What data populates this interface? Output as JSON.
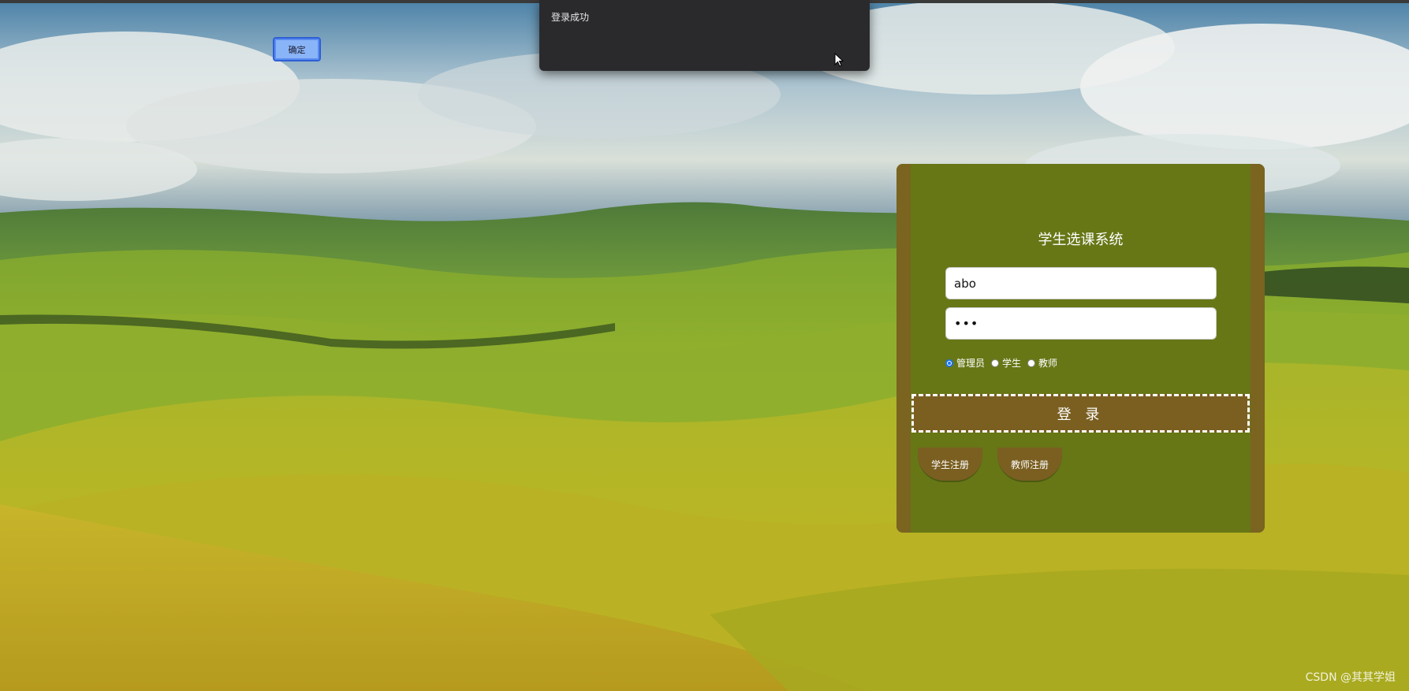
{
  "dialog": {
    "message": "登录成功",
    "ok_label": "确定"
  },
  "login": {
    "title": "学生选课系统",
    "username_value": "abo",
    "password_value": "•••",
    "roles": [
      {
        "label": "管理员",
        "checked": true
      },
      {
        "label": "学生",
        "checked": false
      },
      {
        "label": "教师",
        "checked": false
      }
    ],
    "login_label": "登 录",
    "student_register_label": "学生注册",
    "teacher_register_label": "教师注册"
  },
  "watermark": "CSDN @其其学姐",
  "colors": {
    "panel": "#677716",
    "panel_edge": "#7a6420",
    "button": "#7a5f21",
    "dialog": "#2a2a2d",
    "ok_button": "#8ab4f8"
  }
}
